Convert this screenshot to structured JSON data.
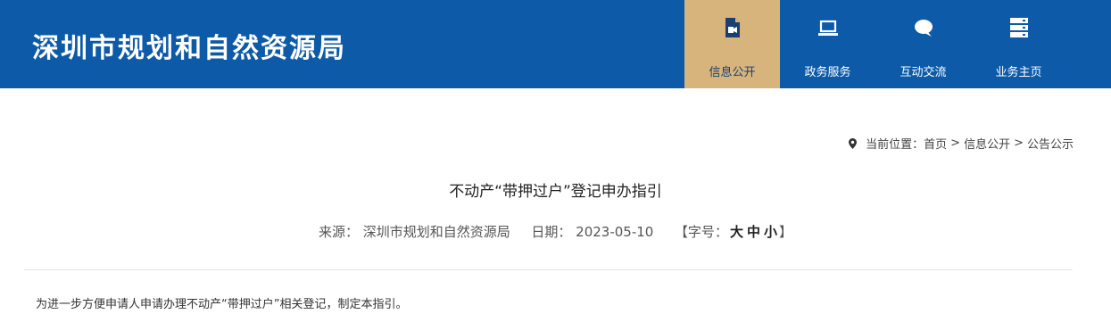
{
  "header": {
    "site_title": "深圳市规划和自然资源局",
    "nav": [
      {
        "label": "信息公开",
        "icon": "media-file-icon",
        "active": true
      },
      {
        "label": "政务服务",
        "icon": "laptop-icon",
        "active": false
      },
      {
        "label": "互动交流",
        "icon": "chat-bubble-icon",
        "active": false
      },
      {
        "label": "业务主页",
        "icon": "server-stack-icon",
        "active": false
      }
    ]
  },
  "breadcrumb": {
    "prefix": "当前位置：",
    "items": [
      "首页",
      "信息公开",
      "公告公示"
    ],
    "separator": ">"
  },
  "article": {
    "title": "不动产“带押过户”登记申办指引",
    "source_label": "来源：",
    "source": "深圳市规划和自然资源局",
    "date_label": "日期：",
    "date": "2023-05-10",
    "font_size_open": "【字号：",
    "font_size_large": "大",
    "font_size_medium": "中",
    "font_size_small": "小",
    "font_size_close": "】",
    "intro": "为进一步方便申请人申请办理不动产“带押过户”相关登记，制定本指引。"
  },
  "colors": {
    "header_bg": "#0c5aa8",
    "active_tab_bg": "#d6b47c"
  }
}
